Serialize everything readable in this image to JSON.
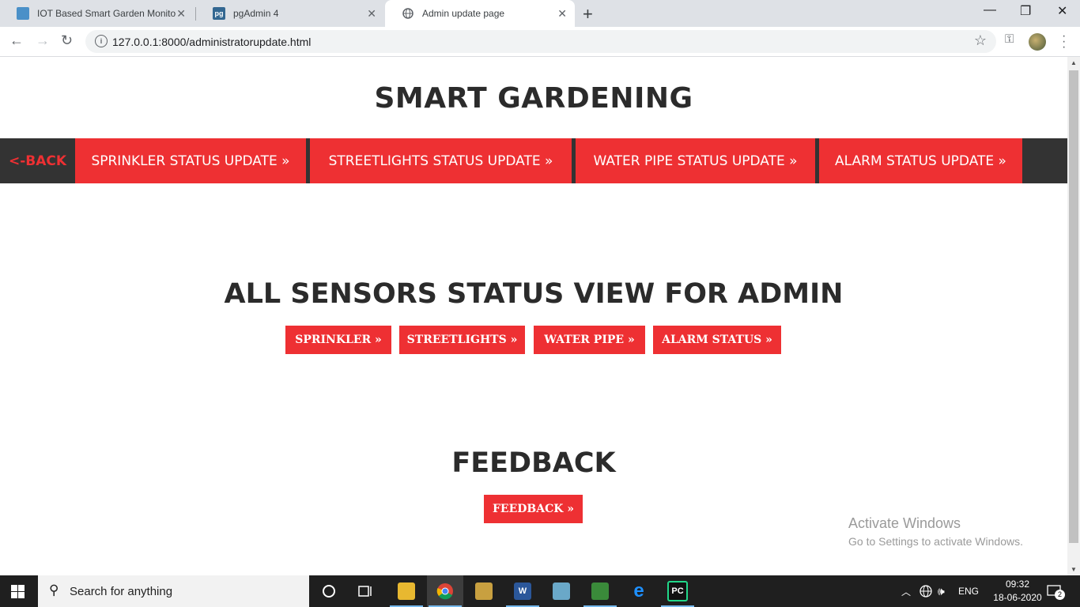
{
  "browser": {
    "tabs": [
      {
        "title": "IOT Based Smart Garden Monitor",
        "icon": "garden-favicon"
      },
      {
        "title": "pgAdmin 4",
        "icon": "pgadmin-favicon",
        "icon_text": "pg"
      },
      {
        "title": "Admin update page",
        "icon": "globe-icon"
      }
    ],
    "new_tab": "+",
    "url": "127.0.0.1:8000/administratorupdate.html",
    "window_controls": {
      "minimize": "—",
      "restore": "❐",
      "close": "✕"
    }
  },
  "page": {
    "site_title": "SMART GARDENING",
    "nav": {
      "back": "<-BACK",
      "items": [
        "SPRINKLER STATUS UPDATE »",
        "STREETLIGHTS STATUS UPDATE »",
        "WATER PIPE STATUS UPDATE »",
        "ALARM STATUS UPDATE »"
      ]
    },
    "sensors_title": "ALL SENSORS STATUS VIEW FOR ADMIN",
    "sensor_buttons": [
      "SPRINKLER »",
      "STREETLIGHTS »",
      "WATER PIPE »",
      "ALARM STATUS »"
    ],
    "feedback_title": "FEEDBACK",
    "feedback_button": "FEEDBACK »",
    "watermark": {
      "line1": "Activate Windows",
      "line2": "Go to Settings to activate Windows."
    }
  },
  "taskbar": {
    "search_placeholder": "Search for anything",
    "pinned": [
      "task-view",
      "file-explorer",
      "chrome",
      "folder-app",
      "word",
      "notes-app",
      "project-app",
      "edge",
      "pycharm"
    ],
    "language": "ENG",
    "time": "09:32",
    "date": "18-06-2020",
    "notification_count": "2"
  },
  "colors": {
    "accent": "#ee3033",
    "navbar": "#333333",
    "title_text": "#2b2b2b"
  }
}
